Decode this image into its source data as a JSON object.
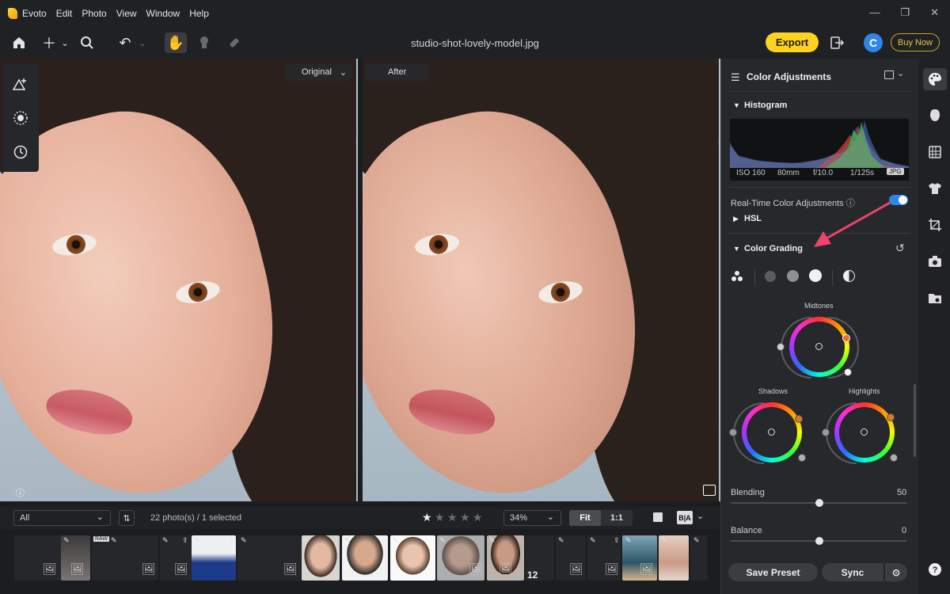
{
  "app": {
    "name": "Evoto",
    "menus": [
      "Edit",
      "Photo",
      "View",
      "Window",
      "Help"
    ],
    "window_controls": [
      "—",
      "❐",
      "✕"
    ]
  },
  "toolbar": {
    "filename": "studio-shot-lovely-model.jpg",
    "export_label": "Export",
    "avatar_letter": "C",
    "buy_now_label": "Buy Now",
    "icons": [
      "home-icon",
      "add-icon",
      "search-icon",
      "undo-icon",
      "hand-icon",
      "stamp-icon",
      "eraser-icon"
    ]
  },
  "viewer": {
    "original_label": "Original",
    "after_label": "After"
  },
  "panel": {
    "title": "Color Adjustments",
    "histogram_title": "Histogram",
    "exif": {
      "iso": "ISO 160",
      "focal": "80mm",
      "aperture": "f/10.0",
      "shutter": "1/125s",
      "format": "JPG"
    },
    "realtime_label": "Real-Time Color Adjustments ⓘ",
    "realtime_on": true,
    "hsl_title": "HSL",
    "grading_title": "Color Grading",
    "midtones_label": "Midtones",
    "shadows_label": "Shadows",
    "highlights_label": "Highlights",
    "blending_label": "Blending",
    "blending_value": "50",
    "balance_label": "Balance",
    "balance_value": "0",
    "save_preset_label": "Save Preset",
    "sync_label": "Sync"
  },
  "bottom": {
    "filter_value": "All",
    "count_text": "22 photo(s) / 1 selected",
    "zoom_value": "34%",
    "fit_label": "Fit",
    "one_to_one_label": "1:1",
    "rating": 1,
    "rating_max": 5,
    "raw_badge": "RAW",
    "page_number": "12"
  },
  "colors": {
    "accent": "#ffd21f",
    "toggle": "#2f86e8",
    "arrow": "#f0436c"
  }
}
